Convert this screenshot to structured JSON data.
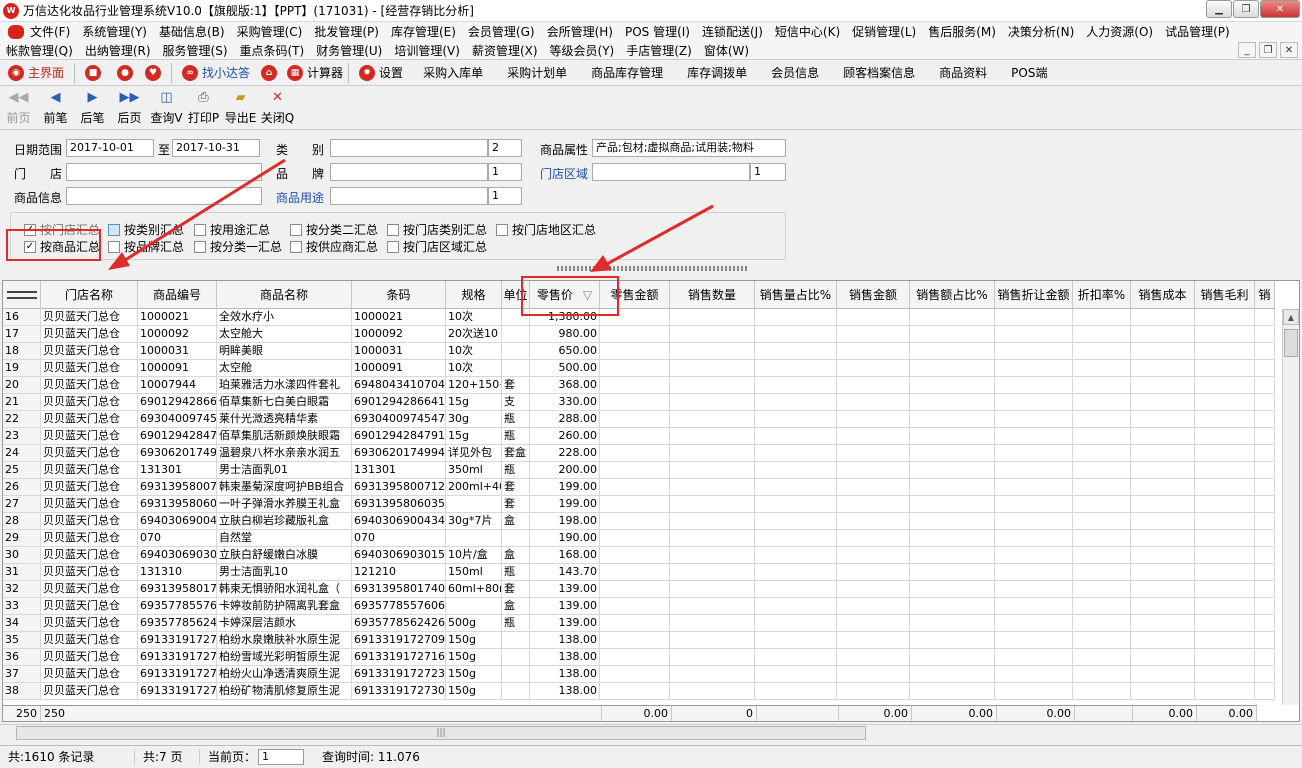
{
  "window": {
    "title": "万信达化妆品行业管理系统V10.0【旗舰版:1】【PPT】(171031) - [经营存销比分析]"
  },
  "menu": {
    "row1": [
      "文件(F)",
      "系统管理(Y)",
      "基础信息(B)",
      "采购管理(C)",
      "批发管理(P)",
      "库存管理(E)",
      "会员管理(G)",
      "会所管理(H)",
      "POS 管理(I)",
      "连锁配送(J)",
      "短信中心(K)",
      "促销管理(L)",
      "售后服务(M)",
      "决策分析(N)",
      "人力资源(O)",
      "试品管理(P)"
    ],
    "row2": [
      "帐款管理(Q)",
      "出纳管理(R)",
      "服务管理(S)",
      "重点条码(T)",
      "财务管理(U)",
      "培训管理(V)",
      "薪资管理(X)",
      "等级会员(Y)",
      "手店管理(Z)",
      "窗体(W)"
    ]
  },
  "quick": {
    "home": "主界面",
    "find": "找小达答",
    "calc": "计算器",
    "settings": "设置",
    "links": [
      "采购入库单",
      "采购计划单",
      "商品库存管理",
      "库存调拨单",
      "会员信息",
      "顾客档案信息",
      "商品资料",
      "POS端"
    ]
  },
  "toolbar": {
    "first": "前页",
    "prev": "前笔",
    "next": "后笔",
    "last": "后页",
    "query": "查询V",
    "print": "打印P",
    "export": "导出E",
    "close": "关闭Q"
  },
  "filters": {
    "date_label": "日期范围",
    "date_from": "2017-10-01",
    "to_label": "至",
    "date_to": "2017-10-31",
    "category_label": "类　　别",
    "category_value": "2",
    "store_label": "门　　店",
    "brand_label": "品　　牌",
    "brand_value": "1",
    "product_info_label": "商品信息",
    "usage_label": "商品用途",
    "usage_value": "1",
    "attr_label": "商品属性",
    "attr_value": "产品;包材;虚拟商品;试用装;物料",
    "region_label": "门店区域",
    "region_value": "1"
  },
  "options": {
    "by_store": "按门店汇总",
    "by_category": "按类别汇总",
    "by_usage": "按用途汇总",
    "by_cat2": "按分类二汇总",
    "by_store_category": "按门店类别汇总",
    "by_store_region_area": "按门店地区汇总",
    "by_product": "按商品汇总",
    "by_brand": "按品牌汇总",
    "by_cat1": "按分类一汇总",
    "by_supplier": "按供应商汇总",
    "by_store_region": "按门店区域汇总"
  },
  "grid": {
    "headers": {
      "store": "门店名称",
      "code": "商品编号",
      "name": "商品名称",
      "barcode": "条码",
      "spec": "规格",
      "unit": "单位",
      "retail": "零售价",
      "retail_amount": "零售金额",
      "sales_qty": "销售数量",
      "sales_qty_pct": "销售量占比%",
      "sales_amount": "销售金额",
      "sales_amount_pct": "销售额占比%",
      "disc_amount": "销售折让金额",
      "disc_rate": "折扣率%",
      "cost": "销售成本",
      "profit": "销售毛利",
      "more": "销"
    },
    "rows": [
      {
        "n": "16",
        "store": "贝贝蓝天门总仓",
        "code": "1000021",
        "name": "全效水疗小",
        "barcode": "1000021",
        "spec": "10次",
        "unit": "",
        "price": "1,380.00"
      },
      {
        "n": "17",
        "store": "贝贝蓝天门总仓",
        "code": "1000092",
        "name": "太空舱大",
        "barcode": "1000092",
        "spec": "20次送10",
        "unit": "",
        "price": "980.00"
      },
      {
        "n": "18",
        "store": "贝贝蓝天门总仓",
        "code": "1000031",
        "name": "明眸美眼",
        "barcode": "1000031",
        "spec": "10次",
        "unit": "",
        "price": "650.00"
      },
      {
        "n": "19",
        "store": "贝贝蓝天门总仓",
        "code": "1000091",
        "name": "太空舱",
        "barcode": "1000091",
        "spec": "10次",
        "unit": "",
        "price": "500.00"
      },
      {
        "n": "20",
        "store": "贝贝蓝天门总仓",
        "code": "10007944",
        "name": "珀莱雅活力水漾四件套礼",
        "barcode": "6948043410704",
        "spec": "120+150+",
        "unit": "套",
        "price": "368.00"
      },
      {
        "n": "21",
        "store": "贝贝蓝天门总仓",
        "code": "6901294286641",
        "name": "佰草集新七白美白眼霜",
        "barcode": "6901294286641",
        "spec": "15g",
        "unit": "支",
        "price": "330.00"
      },
      {
        "n": "22",
        "store": "贝贝蓝天门总仓",
        "code": "6930400974547",
        "name": "莱什光溦透亮精华素",
        "barcode": "6930400974547",
        "spec": "30g",
        "unit": "瓶",
        "price": "288.00"
      },
      {
        "n": "23",
        "store": "贝贝蓝天门总仓",
        "code": "6901294284791",
        "name": "佰草集肌活新颜焕肤眼霜",
        "barcode": "6901294284791",
        "spec": "15g",
        "unit": "瓶",
        "price": "260.00"
      },
      {
        "n": "24",
        "store": "贝贝蓝天门总仓",
        "code": "6930620174994",
        "name": "温碧泉八杯水亲亲水润五",
        "barcode": "6930620174994",
        "spec": "详见外包",
        "unit": "套盒",
        "price": "228.00"
      },
      {
        "n": "25",
        "store": "贝贝蓝天门总仓",
        "code": "131301",
        "name": "男士洁面乳01",
        "barcode": "131301",
        "spec": "350ml",
        "unit": "瓶",
        "price": "200.00"
      },
      {
        "n": "26",
        "store": "贝贝蓝天门总仓",
        "code": "6931395800712",
        "name": "韩束墨菊深度呵护BB组合",
        "barcode": "6931395800712",
        "spec": "200ml+40m",
        "unit": "套",
        "price": "199.00"
      },
      {
        "n": "27",
        "store": "贝贝蓝天门总仓",
        "code": "6931395806035",
        "name": "一叶子弹滑水养膜王礼盒",
        "barcode": "6931395806035",
        "spec": "",
        "unit": "套",
        "price": "199.00"
      },
      {
        "n": "28",
        "store": "贝贝蓝天门总仓",
        "code": "6940306900434",
        "name": "立肤白柳岩珍藏版礼盒",
        "barcode": "6940306900434",
        "spec": "30g*7片",
        "unit": "盒",
        "price": "198.00"
      },
      {
        "n": "29",
        "store": "贝贝蓝天门总仓",
        "code": "070",
        "name": "自然堂",
        "barcode": "070",
        "spec": "",
        "unit": "",
        "price": "190.00"
      },
      {
        "n": "30",
        "store": "贝贝蓝天门总仓",
        "code": "6940306903015",
        "name": "立肤白舒缓嫩白冰膜",
        "barcode": "6940306903015",
        "spec": "10片/盒",
        "unit": "盒",
        "price": "168.00"
      },
      {
        "n": "31",
        "store": "贝贝蓝天门总仓",
        "code": "131310",
        "name": "男士洁面乳10",
        "barcode": "121210",
        "spec": "150ml",
        "unit": "瓶",
        "price": "143.70"
      },
      {
        "n": "32",
        "store": "贝贝蓝天门总仓",
        "code": "6931395801740",
        "name": "韩束无惧骄阳水润礼盒（",
        "barcode": "6931395801740",
        "spec": "60ml+80ml",
        "unit": "套",
        "price": "139.00"
      },
      {
        "n": "33",
        "store": "贝贝蓝天门总仓",
        "code": "6935778557606",
        "name": "卡婷妆前防护隔离乳套盒",
        "barcode": "6935778557606",
        "spec": "",
        "unit": "盒",
        "price": "139.00"
      },
      {
        "n": "34",
        "store": "贝贝蓝天门总仓",
        "code": "6935778562426",
        "name": "卡婷深层洁颜水",
        "barcode": "6935778562426",
        "spec": "500g",
        "unit": "瓶",
        "price": "139.00"
      },
      {
        "n": "35",
        "store": "贝贝蓝天门总仓",
        "code": "6913319172709",
        "name": "柏纷水泉嫩肤补水原生泥",
        "barcode": "6913319172709",
        "spec": "150g",
        "unit": "",
        "price": "138.00"
      },
      {
        "n": "36",
        "store": "贝贝蓝天门总仓",
        "code": "6913319172716",
        "name": "柏纷雪域光彩明皙原生泥",
        "barcode": "6913319172716",
        "spec": "150g",
        "unit": "",
        "price": "138.00"
      },
      {
        "n": "37",
        "store": "贝贝蓝天门总仓",
        "code": "6913319172723",
        "name": "柏纷火山净透清爽原生泥",
        "barcode": "6913319172723",
        "spec": "150g",
        "unit": "",
        "price": "138.00"
      },
      {
        "n": "38",
        "store": "贝贝蓝天门总仓",
        "code": "6913319172730",
        "name": "柏纷矿物清肌修复原生泥",
        "barcode": "6913319172730",
        "spec": "150g",
        "unit": "",
        "price": "138.00"
      }
    ],
    "footer": {
      "count1": "250",
      "count2": "250",
      "v1": "0.00",
      "v2": "0",
      "v3": "0.00",
      "v4": "0.00",
      "v5": "0.00",
      "v6": "0.00",
      "v7": "0.00",
      "v8": "0.00"
    }
  },
  "status": {
    "total": "共:1610 条记录",
    "pages": "共:7 页",
    "current_label": "当前页：",
    "current": "1",
    "query_time": "查询时间: 11.076"
  },
  "colors": {
    "annotation": "#e02b2b",
    "link_blue": "#1b4fb0"
  }
}
